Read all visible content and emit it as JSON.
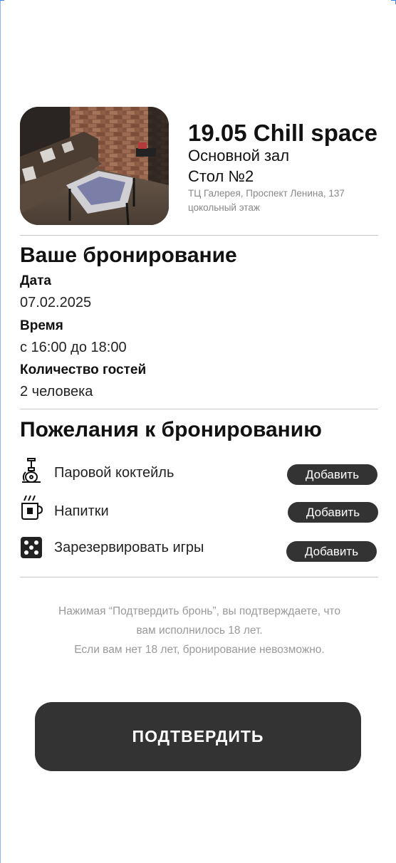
{
  "venue": {
    "title": "19.05 Chill space",
    "hall": "Основной зал",
    "table": "Стол №2",
    "address_line1": "ТЦ Галерея, Проспект Ленина, 137",
    "address_line2": "цокольный этаж"
  },
  "booking": {
    "heading": "Ваше бронирование",
    "date_label": "Дата",
    "date_value": "07.02.2025",
    "time_label": "Время",
    "time_value": "с 16:00 до 18:00",
    "guests_label": "Количество гостей",
    "guests_value": "2 человека"
  },
  "wishes": {
    "heading": "Пожелания к бронированию",
    "items": [
      {
        "label": "Паровой коктейль",
        "button": "Добавить",
        "icon": "hookah-icon"
      },
      {
        "label": "Напитки",
        "button": "Добавить",
        "icon": "hot-drink-icon"
      },
      {
        "label": "Зарезервировать игры",
        "button": "Добавить",
        "icon": "dice-icon"
      }
    ]
  },
  "notice": {
    "line1": "Нажимая “Подтвердить бронь”, вы подтверждаете, что",
    "line2": "вам исполнилось 18 лет.",
    "line3": "Если вам нет 18 лет, бронирование невозможно."
  },
  "confirm_label": "ПОДТВЕРДИТЬ",
  "colors": {
    "button": "#333333",
    "divider": "#c8c8c8",
    "muted": "#999999"
  }
}
